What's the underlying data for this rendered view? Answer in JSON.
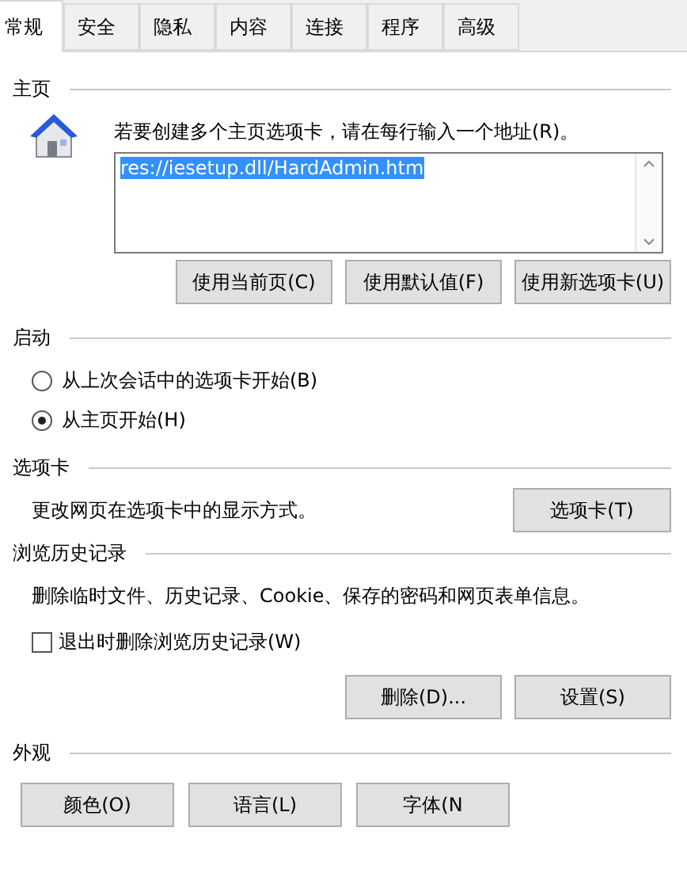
{
  "tabs": [
    {
      "label": "常规",
      "selected": true
    },
    {
      "label": "安全",
      "selected": false
    },
    {
      "label": "隐私",
      "selected": false
    },
    {
      "label": "内容",
      "selected": false
    },
    {
      "label": "连接",
      "selected": false
    },
    {
      "label": "程序",
      "selected": false
    },
    {
      "label": "高级",
      "selected": false
    }
  ],
  "home_page": {
    "title": "主页",
    "description": "若要创建多个主页选项卡，请在每行输入一个地址(R)。",
    "value": "res://iesetup.dll/HardAdmin.htm",
    "buttons": [
      "使用当前页(C)",
      "使用默认值(F)",
      "使用新选项卡(U)"
    ]
  },
  "startup": {
    "title": "启动",
    "options": [
      {
        "label": "从上次会话中的选项卡开始(B)",
        "selected": false
      },
      {
        "label": "从主页开始(H)",
        "selected": true
      }
    ]
  },
  "tabs_section": {
    "title": "选项卡",
    "description": "更改网页在选项卡中的显示方式。",
    "button": "选项卡(T)"
  },
  "history": {
    "title": "浏览历史记录",
    "description": "删除临时文件、历史记录、Cookie、保存的密码和网页表单信息。",
    "checkbox": {
      "label": "退出时删除浏览历史记录(W)",
      "checked": false
    },
    "buttons": [
      "删除(D)...",
      "设置(S)"
    ]
  },
  "appearance": {
    "title": "外观",
    "buttons": [
      "颜色(O)",
      "语言(L)",
      "字体(N"
    ]
  }
}
